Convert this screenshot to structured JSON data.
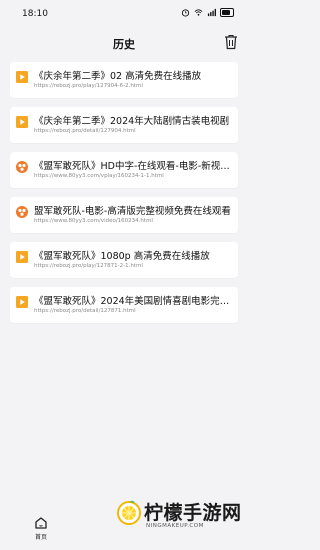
{
  "status_bar": {
    "time": "18:10"
  },
  "header": {
    "title": "历史"
  },
  "history": [
    {
      "icon": "video-play-icon",
      "title": "《庆余年第二季》02 高清免费在线播放",
      "url": "https://rebozj.pro/play/127904-6-2.html"
    },
    {
      "icon": "video-play-icon",
      "title": "《庆余年第二季》2024年大陆剧情古装电视剧",
      "url": "https://rebozj.pro/detail/127904.html"
    },
    {
      "icon": "site-favicon-icon",
      "title": "《盟军敢死队》HD中字-在线观看-电影-新视觉影院",
      "url": "https://www.80yy3.com/vplay/160234-1-1.html"
    },
    {
      "icon": "site-favicon-icon",
      "title": "盟军敢死队-电影-高清版完整视频免费在线观看",
      "url": "https://www.80yy3.com/video/160234.html"
    },
    {
      "icon": "video-play-icon",
      "title": "《盟军敢死队》1080p 高清免费在线播放",
      "url": "https://rebozj.pro/play/127871-2-1.html"
    },
    {
      "icon": "video-play-icon",
      "title": "《盟军敢死队》2024年美国剧情喜剧电影完整版",
      "url": "https://rebozj.pro/detail/127871.html"
    }
  ],
  "tabbar": {
    "home_label": "首页"
  },
  "watermark": {
    "text": "柠檬手游网",
    "sub": "NINGMAKEUP.COM"
  },
  "colors": {
    "accent_orange": "#f5a623",
    "favicon_orange": "#f07a2c",
    "background": "#f3f3f5"
  }
}
